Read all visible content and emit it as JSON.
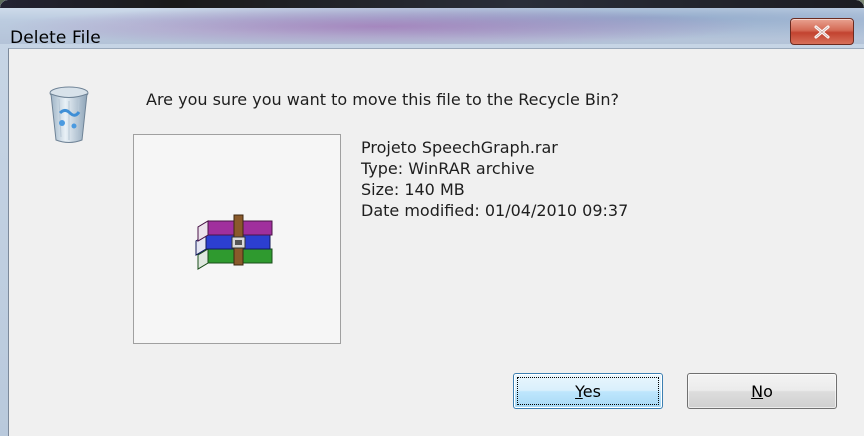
{
  "window": {
    "title": "Delete File",
    "close_symbol": "x"
  },
  "dialog": {
    "message": "Are you sure you want to move this file to the Recycle Bin?",
    "icon": "recycle-bin-icon",
    "file_icon": "winrar-archive-icon",
    "file": {
      "name": "Projeto SpeechGraph.rar",
      "type": "Type: WinRAR archive",
      "size": "Size: 140 MB",
      "date_modified": "Date modified: 01/04/2010 09:37"
    }
  },
  "buttons": {
    "yes": {
      "mnemonic": "Y",
      "rest": "es"
    },
    "no": {
      "mnemonic": "N",
      "rest": "o"
    }
  },
  "colors": {
    "close_button": "#c24330",
    "default_button_border": "#3c7fb1",
    "client_background": "#f0f0f0"
  }
}
